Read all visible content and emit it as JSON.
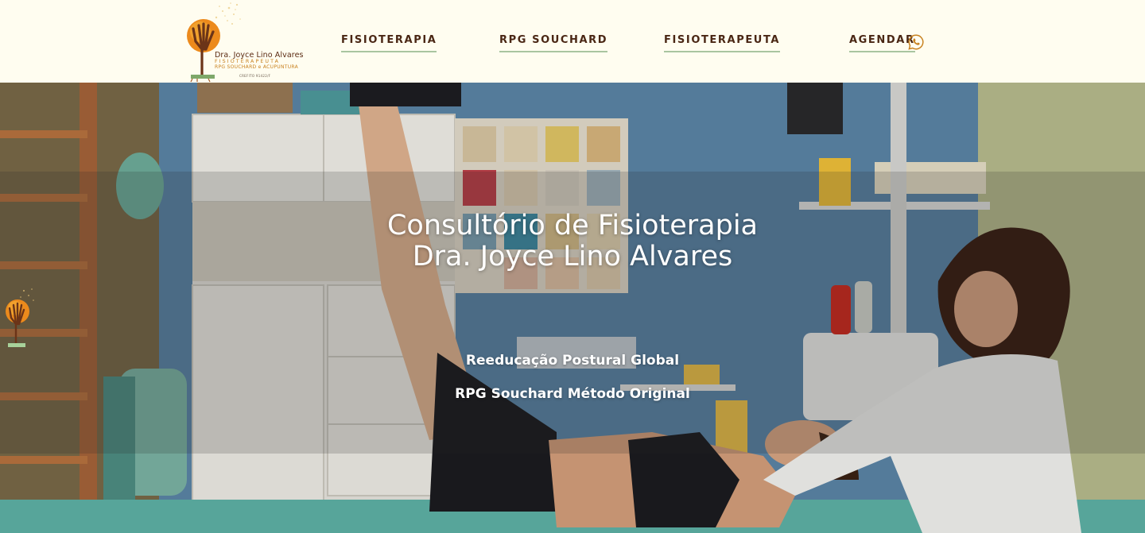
{
  "header": {
    "logo": {
      "name": "Dra. Joyce Lino Alvares",
      "profession": "FISIOTERAPEUTA",
      "subtitle": "RPG SOUCHARD e ACUPUNTURA",
      "registration": "CREFITO 91422/F"
    },
    "nav": {
      "item1": "FISIOTERAPIA",
      "item2": "RPG SOUCHARD",
      "item3": "FISIOTERAPEUTA",
      "item4": "AGENDAR"
    },
    "icons": {
      "whatsapp": "whatsapp-icon"
    }
  },
  "hero": {
    "title_line1": "Consultório de Fisioterapia",
    "title_line2": "Dra. Joyce Lino Alvares",
    "subtitle1": "Reeducação Postural Global",
    "subtitle2": "RPG Souchard Método Original"
  },
  "colors": {
    "header_bg": "#fffdf0",
    "nav_text": "#4a2714",
    "nav_underline": "#a9c5a0",
    "logo_orange": "#e8891f",
    "logo_brown": "#6b3418",
    "hero_text": "#ffffff"
  }
}
